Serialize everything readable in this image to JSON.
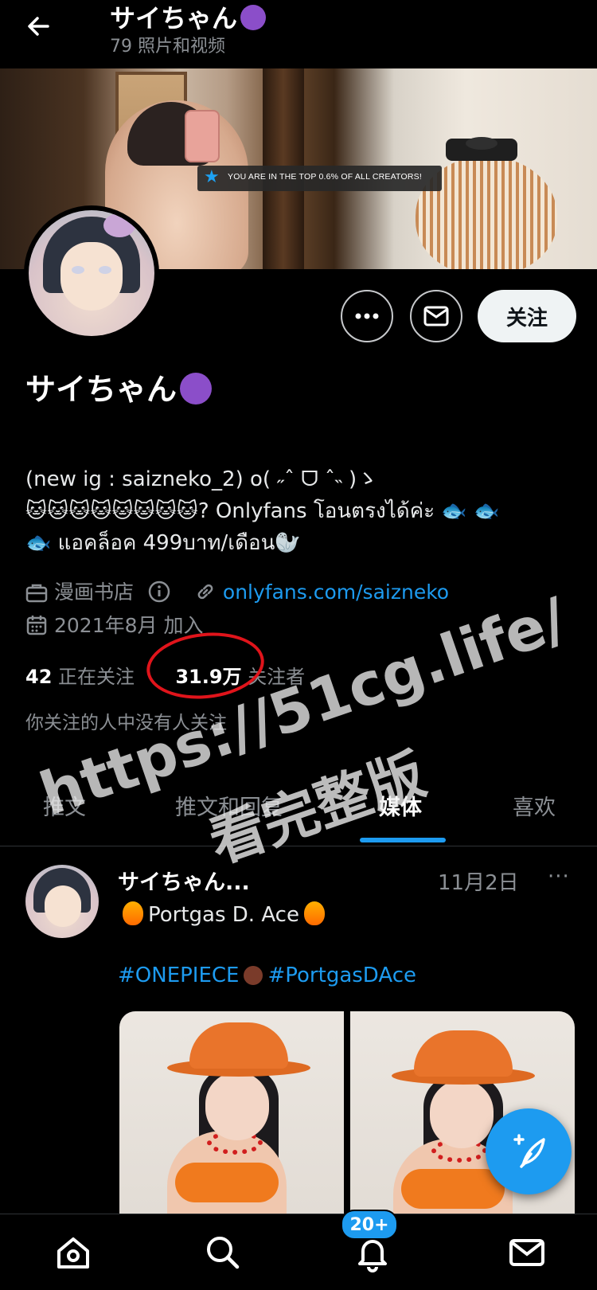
{
  "header": {
    "title": "サイちゃん",
    "subtitle": "79 照片和视频"
  },
  "banner": {
    "badge_text": "YOU ARE IN THE TOP 0.6% OF ALL CREATORS!"
  },
  "actions": {
    "follow_label": "关注"
  },
  "profile": {
    "display_name": "サイちゃん",
    "bio_line1": "(new ig : saizneko_2) o( ˶ˆ ᗜ ˆ˵ )ゝ",
    "bio_line2": "🐱🐱🐱🐱🐱🐱🐱🐱? Onlyfans โอนตรงได้ค่ะ 🐟 🐟",
    "bio_line3": "🐟 แอคล็อค 499บาท/เดือน🦭",
    "category": "漫画书店",
    "website": "onlyfans.com/saizneko",
    "joined": "2021年8月 加入",
    "following_count": "42",
    "following_label": "正在关注",
    "followers_count": "31.9万",
    "followers_label": "关注者",
    "followed_by_note": "你关注的人中没有人关注"
  },
  "tabs": [
    {
      "label": "推文",
      "active": false
    },
    {
      "label": "推文和回复",
      "active": true
    },
    {
      "label": "媒体",
      "active": true
    },
    {
      "label": "喜欢",
      "active": false
    }
  ],
  "tweet": {
    "author": "サイちゃん...",
    "date": "11月2日",
    "more": "···",
    "text": "Portgas D. Ace",
    "hashtag1": "#ONEPIECE",
    "hashtag2": "#PortgasDAce"
  },
  "bottom_nav": {
    "notification_badge": "20+"
  },
  "watermark": {
    "line1": "https://51cg.life/",
    "line2": "看完整版"
  },
  "colors": {
    "accent": "#1d9bf0",
    "background": "#000000",
    "secondary_text": "#8b8f94",
    "annotation_red": "#e0141b"
  },
  "icons": {
    "back": "arrow-left-icon",
    "more": "more-horizontal-icon",
    "message": "envelope-icon",
    "category": "briefcase-icon",
    "info": "info-circle-icon",
    "link": "link-icon",
    "calendar": "calendar-icon",
    "compose": "feather-plus-icon",
    "home": "home-icon",
    "search": "search-icon",
    "notifications": "bell-icon",
    "messages": "envelope-icon"
  }
}
